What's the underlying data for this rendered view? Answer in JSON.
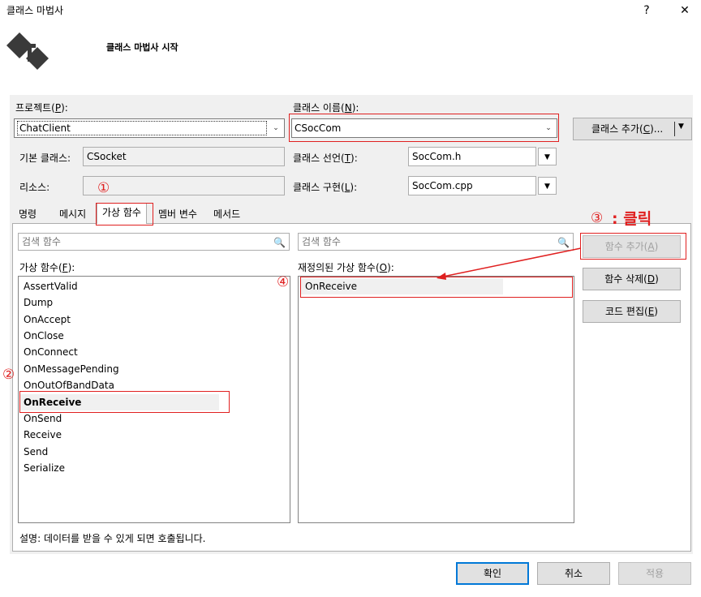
{
  "window": {
    "title": "클래스 마법사",
    "help": "?",
    "close": "✕"
  },
  "header": {
    "title": "클래스 마법사 시작"
  },
  "project": {
    "label": "프로젝트(",
    "mnemonic": "P",
    "label_end": "):",
    "value": "ChatClient"
  },
  "class_name": {
    "label": "클래스 이름(",
    "mnemonic": "N",
    "label_end": "):",
    "value": "CSocCom"
  },
  "add_class": {
    "label": "클래스 추가(",
    "mnemonic": "C",
    "label_end": ")..."
  },
  "base_class": {
    "label": "기본 클래스:",
    "value": "CSocket"
  },
  "resource": {
    "label": "리소스:",
    "value": ""
  },
  "class_decl": {
    "label": "클래스 선언(",
    "mnemonic": "T",
    "label_end": "):",
    "value": "SocCom.h"
  },
  "class_impl": {
    "label": "클래스 구현(",
    "mnemonic": "L",
    "label_end": "):",
    "value": "SocCom.cpp"
  },
  "tabs": [
    "명령",
    "메시지",
    "가상 함수",
    "멤버 변수",
    "메서드"
  ],
  "search": {
    "placeholder_left": "검색 함수",
    "placeholder_right": "검색 함수"
  },
  "virtual_functions": {
    "label": "가상 함수(",
    "mnemonic": "F",
    "label_end": "):",
    "items": [
      "AssertValid",
      "Dump",
      "OnAccept",
      "OnClose",
      "OnConnect",
      "OnMessagePending",
      "OnOutOfBandData",
      "OnReceive",
      "OnSend",
      "Receive",
      "Send",
      "Serialize"
    ],
    "selected": "OnReceive"
  },
  "overridden": {
    "label": "재정의된 가상 함수(",
    "mnemonic": "O",
    "label_end": "):",
    "items": [
      "OnReceive"
    ]
  },
  "buttons": {
    "add_function": {
      "label": "함수 추가(",
      "mnemonic": "A",
      "label_end": ")"
    },
    "delete_function": {
      "label": "함수 삭제(",
      "mnemonic": "D",
      "label_end": ")"
    },
    "edit_code": {
      "label": "코드 편집(",
      "mnemonic": "E",
      "label_end": ")"
    }
  },
  "description": "설명:  데이터를 받을 수 있게 되면 호출됩니다.",
  "footer": {
    "ok": "확인",
    "cancel": "취소",
    "apply": "적용"
  },
  "annotations": {
    "one": "①",
    "two": "②",
    "three": "③",
    "three_text": ": 클릭",
    "four": "④"
  },
  "colors": {
    "annotation": "#e02020",
    "focus": "#0078d7"
  }
}
